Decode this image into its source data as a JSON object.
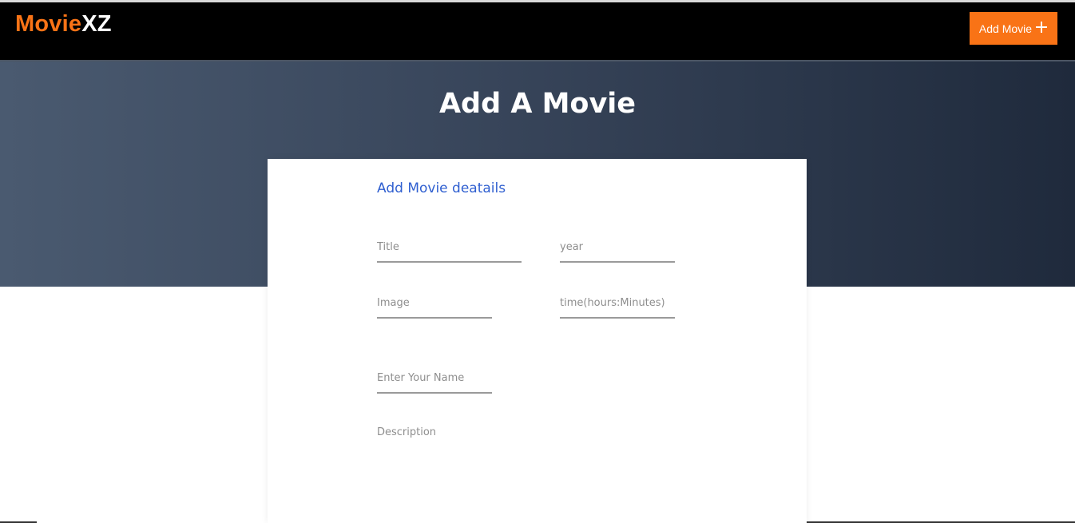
{
  "brand": {
    "part1": "Movie",
    "part2": "XZ"
  },
  "navbar": {
    "add_button_label": "Add Movie",
    "add_button_icon": "plus-icon"
  },
  "hero": {
    "title": "Add A Movie"
  },
  "form": {
    "heading": "Add Movie deatails",
    "fields": {
      "title": {
        "placeholder": "Title",
        "value": ""
      },
      "year": {
        "placeholder": "year",
        "value": ""
      },
      "image": {
        "placeholder": "Image",
        "value": ""
      },
      "time": {
        "placeholder": "time(hours:Minutes)",
        "value": ""
      },
      "name": {
        "placeholder": "Enter Your Name",
        "value": ""
      },
      "description": {
        "placeholder": "Description",
        "value": ""
      }
    }
  },
  "colors": {
    "accent": "#f97316",
    "navbar_bg": "#000000",
    "hero_gradient_start": "#4a5a70",
    "hero_gradient_end": "#1f2a3c",
    "form_heading": "#2f5fd0"
  }
}
